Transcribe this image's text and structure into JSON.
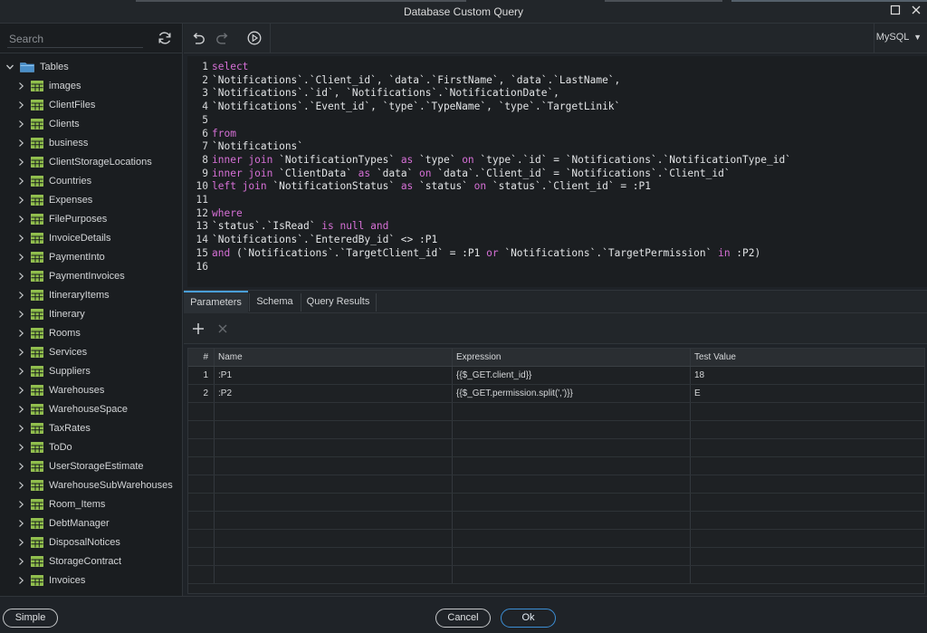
{
  "window": {
    "title": "Database Custom Query"
  },
  "sidebar": {
    "search_placeholder": "Search",
    "root_label": "Tables",
    "tables": [
      "images",
      "ClientFiles",
      "Clients",
      "business",
      "ClientStorageLocations",
      "Countries",
      "Expenses",
      "FilePurposes",
      "InvoiceDetails",
      "PaymentInto",
      "PaymentInvoices",
      "ItineraryItems",
      "Itinerary",
      "Rooms",
      "Services",
      "Suppliers",
      "Warehouses",
      "WarehouseSpace",
      "TaxRates",
      "ToDo",
      "UserStorageEstimate",
      "WarehouseSubWarehouses",
      "Room_Items",
      "DebtManager",
      "DisposalNotices",
      "StorageContract",
      "Invoices"
    ]
  },
  "toolbar": {
    "dialect": "MySQL"
  },
  "editor": {
    "lines": [
      [
        [
          "kw",
          "select"
        ]
      ],
      [
        [
          "id",
          "`Notifications`.`Client_id`, `data`.`FirstName`, `data`.`LastName`,"
        ]
      ],
      [
        [
          "id",
          "`Notifications`.`id`, `Notifications`.`NotificationDate`,"
        ]
      ],
      [
        [
          "id",
          "`Notifications`.`Event_id`, `type`.`TypeName`, `type`.`TargetLinik`"
        ]
      ],
      [],
      [
        [
          "kw",
          "from"
        ]
      ],
      [
        [
          "id",
          "`Notifications`"
        ]
      ],
      [
        [
          "kw",
          "inner join "
        ],
        [
          "id",
          "`NotificationTypes` "
        ],
        [
          "kw",
          "as "
        ],
        [
          "id",
          "`type` "
        ],
        [
          "kw",
          "on "
        ],
        [
          "id",
          "`type`.`id` = `Notifications`.`NotificationType_id`"
        ]
      ],
      [
        [
          "kw",
          "inner join "
        ],
        [
          "id",
          "`ClientData` "
        ],
        [
          "kw",
          "as "
        ],
        [
          "id",
          "`data` "
        ],
        [
          "kw",
          "on "
        ],
        [
          "id",
          "`data`.`Client_id` = `Notifications`.`Client_id`"
        ]
      ],
      [
        [
          "kw",
          "left join "
        ],
        [
          "id",
          "`NotificationStatus` "
        ],
        [
          "kw",
          "as "
        ],
        [
          "id",
          "`status` "
        ],
        [
          "kw",
          "on "
        ],
        [
          "id",
          "`status`.`Client_id` = :P1"
        ]
      ],
      [],
      [
        [
          "kw",
          "where"
        ]
      ],
      [
        [
          "id",
          "`status`.`IsRead` "
        ],
        [
          "kw",
          "is null and"
        ]
      ],
      [
        [
          "id",
          "`Notifications`.`EnteredBy_id` <> :P1"
        ]
      ],
      [
        [
          "kw",
          "and "
        ],
        [
          "id",
          "(`Notifications`.`TargetClient_id` = :P1 "
        ],
        [
          "kw",
          "or "
        ],
        [
          "id",
          "`Notifications`.`TargetPermission` "
        ],
        [
          "kw",
          "in "
        ],
        [
          "id",
          ":P2)"
        ]
      ],
      []
    ]
  },
  "tabs": [
    "Parameters",
    "Schema",
    "Query Results"
  ],
  "active_tab": 0,
  "params": {
    "columns": [
      "#",
      "Name",
      "Expression",
      "Test Value"
    ],
    "rows": [
      [
        "1",
        ":P1",
        "{{$_GET.client_id}}",
        "18"
      ],
      [
        "2",
        ":P2",
        "{{$_GET.permission.split(',')}}",
        "E"
      ]
    ],
    "empty_rows": 10
  },
  "footer": {
    "simple_label": "Simple",
    "cancel_label": "Cancel",
    "ok_label": "Ok"
  }
}
